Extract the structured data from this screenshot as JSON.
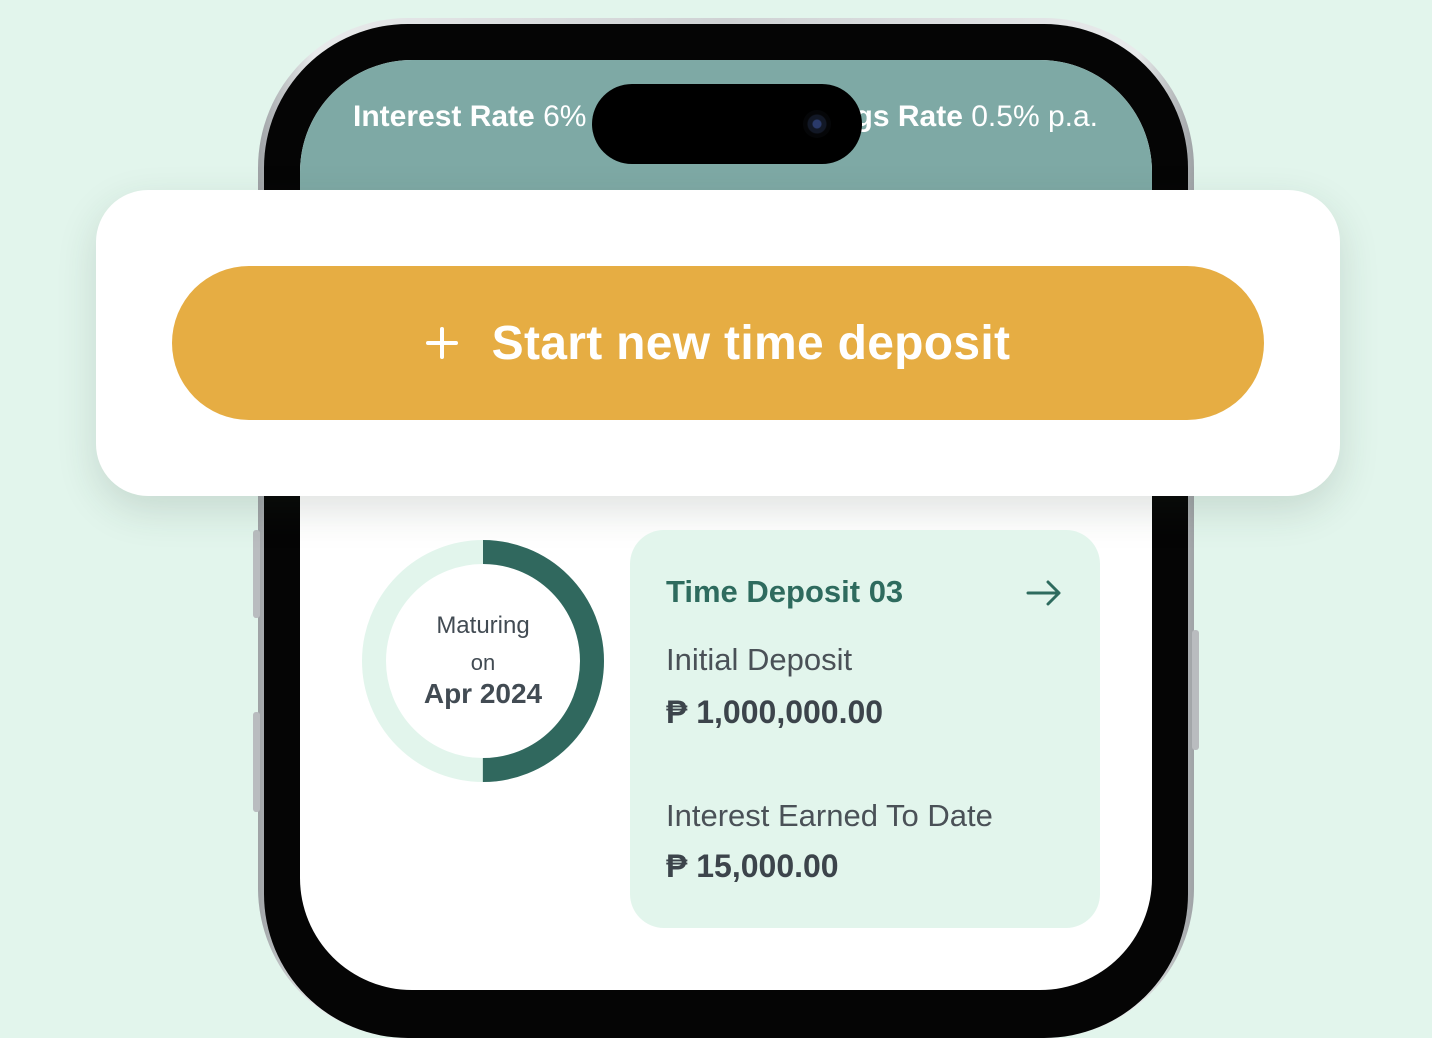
{
  "rates": {
    "interest_label": "Interest Rate",
    "interest_value": "6%",
    "savings_label": "Savings Rate",
    "savings_value": "0.5% p.a."
  },
  "cta": {
    "icon": "plus-icon",
    "label": "Start new time deposit"
  },
  "maturity": {
    "line1": "Maturing",
    "line2": "on",
    "date": "Apr 2024",
    "progress_fraction": 0.5
  },
  "deposit": {
    "title": "Time Deposit 03",
    "arrow_icon": "arrow-right-icon",
    "initial_label": "Initial Deposit",
    "initial_value": "₱ 1,000,000.00",
    "interest_label": "Interest Earned To Date",
    "interest_value": "₱ 15,000.00"
  },
  "colors": {
    "background": "#e2f5ec",
    "header_band": "#7ea9a5",
    "cta": "#e6ad43",
    "ring_progress": "#30685e",
    "ring_track": "#e2f5ec",
    "title_green": "#2e6b5e"
  }
}
